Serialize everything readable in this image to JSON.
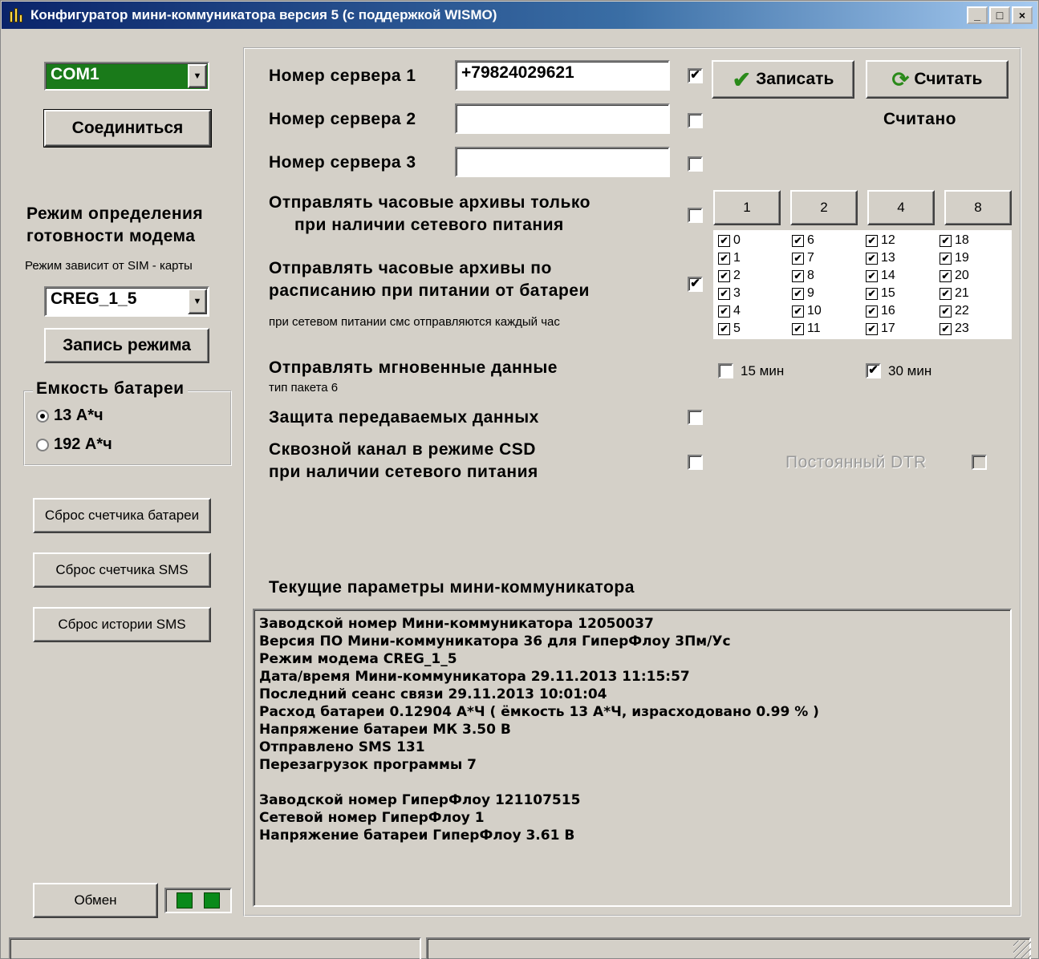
{
  "window": {
    "title": "Конфигуратор мини-коммуникатора  версия 5 (с поддержкой WISMO)",
    "min_glyph": "_",
    "max_glyph": "□",
    "close_glyph": "×"
  },
  "left": {
    "port_combo": {
      "value": "COM1",
      "color": "#1a7a1a"
    },
    "connect_button": "Соединиться",
    "mode_title_line1": "Режим определения",
    "mode_title_line2": "готовности модема",
    "mode_hint": "Режим зависит от SIM - карты",
    "mode_combo": {
      "value": "CREG_1_5"
    },
    "write_mode_button": "Запись режима",
    "battery_group": {
      "title": "Емкость батареи",
      "options": [
        {
          "label": "13 А*ч",
          "selected": true
        },
        {
          "label": "192 А*ч",
          "selected": false
        }
      ]
    },
    "reset_battery_button": "Сброс счетчика батареи",
    "reset_sms_counter_button": "Сброс счетчика SMS",
    "reset_sms_history_button": "Сброс истории SMS",
    "exchange_button": "Обмен"
  },
  "servers": [
    {
      "label": "Номер сервера 1",
      "value": "+79824029621",
      "checked": true
    },
    {
      "label": "Номер сервера 2",
      "value": "",
      "checked": false
    },
    {
      "label": "Номер сервера 3",
      "value": "",
      "checked": false
    }
  ],
  "actions": {
    "write_button": "Записать",
    "read_button": "Считать",
    "status": "Считано"
  },
  "hourly_mains": {
    "line1": "Отправлять часовые архивы только",
    "line2": "при наличии сетевого питания",
    "checked": false
  },
  "hour_step_buttons": [
    "1",
    "2",
    "4",
    "8"
  ],
  "hourly_battery": {
    "line1": "Отправлять часовые архивы по",
    "line2": "расписанию при питании от батареи",
    "checked": true,
    "note": "при сетевом питании смс отправляются каждый час"
  },
  "hours": [
    {
      "label": "0",
      "checked": true
    },
    {
      "label": "1",
      "checked": true
    },
    {
      "label": "2",
      "checked": true
    },
    {
      "label": "3",
      "checked": true
    },
    {
      "label": "4",
      "checked": true
    },
    {
      "label": "5",
      "checked": true
    },
    {
      "label": "6",
      "checked": true
    },
    {
      "label": "7",
      "checked": true
    },
    {
      "label": "8",
      "checked": true
    },
    {
      "label": "9",
      "checked": true
    },
    {
      "label": "10",
      "checked": true
    },
    {
      "label": "11",
      "checked": true
    },
    {
      "label": "12",
      "checked": true
    },
    {
      "label": "13",
      "checked": true
    },
    {
      "label": "14",
      "checked": true
    },
    {
      "label": "15",
      "checked": true
    },
    {
      "label": "16",
      "checked": true
    },
    {
      "label": "17",
      "checked": true
    },
    {
      "label": "18",
      "checked": true
    },
    {
      "label": "19",
      "checked": true
    },
    {
      "label": "20",
      "checked": true
    },
    {
      "label": "21",
      "checked": true
    },
    {
      "label": "22",
      "checked": true
    },
    {
      "label": "23",
      "checked": true
    }
  ],
  "instant": {
    "label": "Отправлять мгновенные данные",
    "sublabel": "тип пакета 6",
    "opt15": {
      "label": "15 мин",
      "checked": false
    },
    "opt30": {
      "label": "30 мин",
      "checked": true
    }
  },
  "protect": {
    "label": "Защита передаваемых данных",
    "checked": false
  },
  "csd": {
    "line1": "Сквозной канал в режиме CSD",
    "line2": "при наличии сетевого питания",
    "checked": false,
    "dtr_label": "Постоянный DTR",
    "dtr_checked": false
  },
  "params": {
    "title": "Текущие параметры мини-коммуникатора",
    "lines": [
      "Заводской номер Мини-коммуникатора  12050037",
      "Версия ПО Мини-коммуникатора  36 для ГиперФлоу 3Пм/Ус",
      "Режим модема  CREG_1_5",
      "Дата/время Мини-коммуникатора  29.11.2013 11:15:57",
      "Последний сеанс связи  29.11.2013 10:01:04",
      "Расход батареи  0.12904  А*Ч  ( ёмкость 13 А*Ч, израсходовано 0.99 % )",
      "Напряжение батареи МК  3.50  В",
      "Отправлено SMS 131",
      "Перезагрузок программы 7",
      "",
      "Заводской номер ГиперФлоу  121107515",
      "Сетевой номер ГиперФлоу  1",
      "Напряжение батареи ГиперФлоу  3.61  В"
    ]
  }
}
